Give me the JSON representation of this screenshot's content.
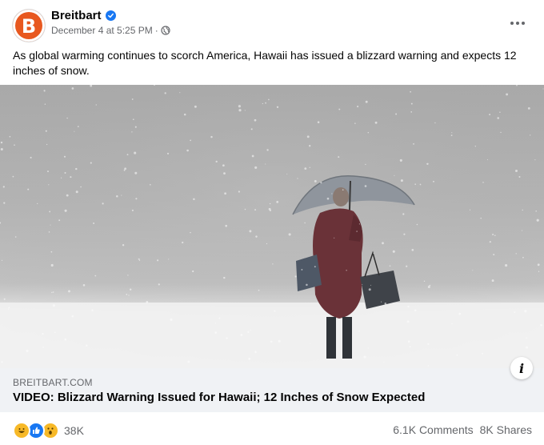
{
  "post": {
    "page_name": "Breitbart",
    "avatar_letter": "B",
    "timestamp": "December 4 at 5:25 PM",
    "separator": "·",
    "privacy_icon": "globe-icon",
    "verified_icon": "verified-badge-icon",
    "text": "As global warming continues to scorch America, Hawaii has issued a blizzard warning and expects 12 inches of snow."
  },
  "media": {
    "description_icon": "snow-scene-image"
  },
  "link": {
    "domain": "BREITBART.COM",
    "title": "VIDEO: Blizzard Warning Issued for Hawaii; 12 Inches of Snow Expected",
    "info_symbol": "i"
  },
  "footer": {
    "reaction_icons": [
      "haha-icon",
      "like-icon",
      "wow-icon"
    ],
    "reaction_count": "38K",
    "comments": "6.1K Comments",
    "shares": "8K Shares"
  },
  "colors": {
    "brand": "#e8581f",
    "facebook_blue": "#1877f2",
    "secondary_text": "#65676b",
    "link_bg": "#f0f2f5"
  }
}
